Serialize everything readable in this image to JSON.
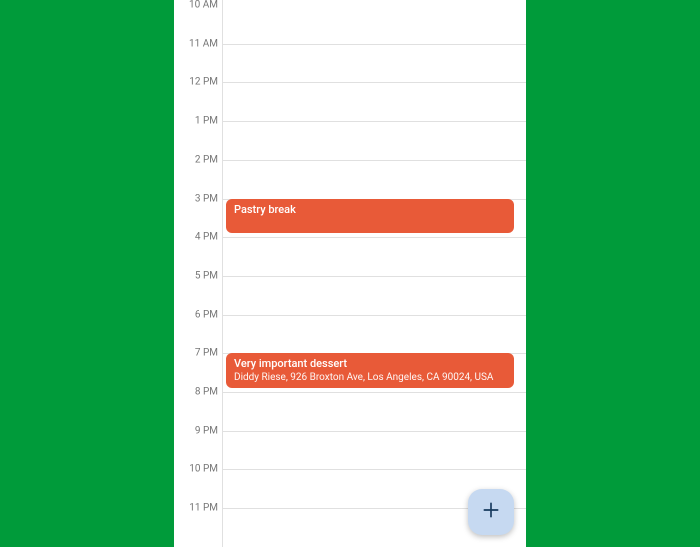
{
  "calendar": {
    "hourHeight": 38.7,
    "firstHour": 10,
    "hours": [
      "10 AM",
      "11 AM",
      "12 PM",
      "1 PM",
      "2 PM",
      "3 PM",
      "4 PM",
      "5 PM",
      "6 PM",
      "7 PM",
      "8 PM",
      "9 PM",
      "10 PM",
      "11 PM"
    ],
    "events": [
      {
        "title": "Pastry break",
        "location": "",
        "startHour": 15,
        "durationHours": 0.9,
        "color": "#e85a38"
      },
      {
        "title": "Very important dessert",
        "location": "Diddy Riese, 926 Broxton Ave, Los Angeles, CA 90024, USA",
        "startHour": 19,
        "durationHours": 0.9,
        "color": "#e85a38"
      }
    ]
  },
  "colors": {
    "background": "#009b3a",
    "eventDefault": "#e85a38",
    "fab": "#c6d9f1"
  }
}
